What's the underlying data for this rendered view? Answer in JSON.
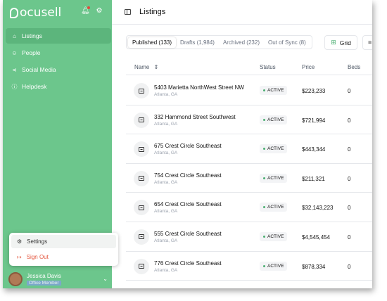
{
  "app": {
    "logo_text": "ocusell"
  },
  "sidebar": {
    "items": [
      {
        "label": "Listings",
        "icon": "home-icon"
      },
      {
        "label": "People",
        "icon": "people-icon"
      },
      {
        "label": "Social Media",
        "icon": "share-icon"
      },
      {
        "label": "Helpdesk",
        "icon": "info-icon"
      }
    ],
    "active_index": 0
  },
  "popup": {
    "settings_label": "Settings",
    "signout_label": "Sign Out"
  },
  "user": {
    "name": "Jessica Davis",
    "role": "Office Member"
  },
  "header": {
    "title": "Listings"
  },
  "tabs": [
    {
      "label": "Published (133)",
      "active": true
    },
    {
      "label": "Drafts (1,984)",
      "active": false
    },
    {
      "label": "Archived (232)",
      "active": false
    },
    {
      "label": "Out of Sync (8)",
      "active": false
    }
  ],
  "toolbar": {
    "grid_label": "Grid"
  },
  "table": {
    "headers": [
      "Name",
      "Status",
      "Price",
      "Beds"
    ],
    "rows": [
      {
        "address": "5403 Marietta NorthWest Street NW",
        "city": "Atlanta, GA",
        "status": "ACTIVE",
        "price": "$223,233",
        "beds": "0"
      },
      {
        "address": "332 Hammond Street Southwest",
        "city": "Atlanta, GA",
        "status": "ACTIVE",
        "price": "$721,994",
        "beds": "0"
      },
      {
        "address": "675 Crest Circle Southeast",
        "city": "Atlanta, GA",
        "status": "ACTIVE",
        "price": "$443,344",
        "beds": "0"
      },
      {
        "address": "754 Crest Circle Southeast",
        "city": "Atlanta, GA",
        "status": "ACTIVE",
        "price": "$211,321",
        "beds": "0"
      },
      {
        "address": "654 Crest Circle Southeast",
        "city": "Atlanta, GA",
        "status": "ACTIVE",
        "price": "$32,143,223",
        "beds": "0"
      },
      {
        "address": "555 Crest Circle Southeast",
        "city": "Atlanta, GA",
        "status": "ACTIVE",
        "price": "$4,545,454",
        "beds": "0"
      },
      {
        "address": "776 Crest Circle Southeast",
        "city": "Atlanta, GA",
        "status": "ACTIVE",
        "price": "$878,334",
        "beds": "0"
      }
    ]
  },
  "colors": {
    "sidebar_bg": "#6cc68c",
    "accent": "#4caf72",
    "signout": "#e4573f"
  }
}
